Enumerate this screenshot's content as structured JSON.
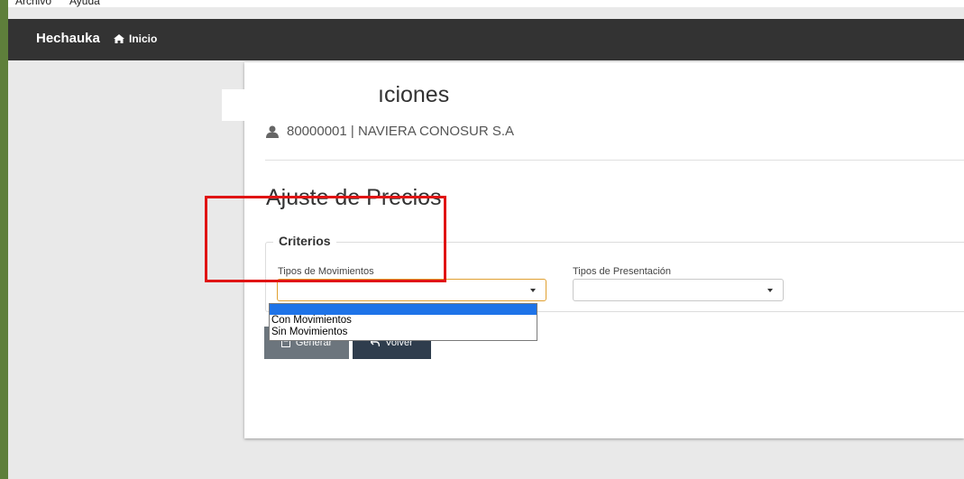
{
  "menu": [
    "Archivo",
    "Ayuda"
  ],
  "navbar": {
    "brand": "Hechauka",
    "home_label": "Inicio"
  },
  "page": {
    "title_visible": "ıciones",
    "company": "80000001 | NAVIERA CONOSUR S.A",
    "section_title": "Ajuste de Precios"
  },
  "criteria": {
    "legend": "Criterios",
    "movimientos_label": "Tipos de Movimientos",
    "presentacion_label": "Tipos de Presentación"
  },
  "dropdown": {
    "options": [
      "Con Movimientos",
      "Sin Movimientos"
    ]
  },
  "buttons": {
    "generar": "Generar",
    "volver": "Volver"
  },
  "colors": {
    "frame": "#5e7f3b",
    "navbar": "#333333",
    "highlight": "#1e73e8",
    "annotation": "#e01414",
    "btn_generar": "#6c757d",
    "btn_volver": "#2f3d4d"
  },
  "icons": [
    "home-icon",
    "user-icon",
    "caret-down-icon",
    "save-icon",
    "undo-icon"
  ]
}
